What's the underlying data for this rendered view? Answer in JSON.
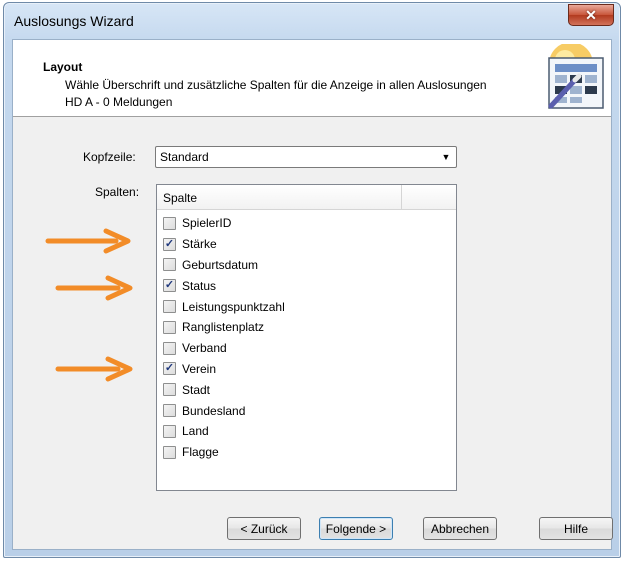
{
  "window": {
    "title": "Auslosungs Wizard",
    "close_glyph": "✕"
  },
  "header": {
    "title": "Layout",
    "description": "Wähle Überschrift und zusätzliche Spalten für die Anzeige in allen Auslosungen",
    "subtitle": "HD A - 0 Meldungen",
    "icon": "wizard-grid-icon"
  },
  "kopfzeile": {
    "label": "Kopfzeile:",
    "value": "Standard"
  },
  "spalten": {
    "label": "Spalten:",
    "column_header": "Spalte",
    "items": [
      {
        "label": "SpielerID",
        "checked": false
      },
      {
        "label": "Stärke",
        "checked": true
      },
      {
        "label": "Geburtsdatum",
        "checked": false
      },
      {
        "label": "Status",
        "checked": true
      },
      {
        "label": "Leistungspunktzahl",
        "checked": false
      },
      {
        "label": "Ranglistenplatz",
        "checked": false
      },
      {
        "label": "Verband",
        "checked": false
      },
      {
        "label": "Verein",
        "checked": true
      },
      {
        "label": "Stadt",
        "checked": false
      },
      {
        "label": "Bundesland",
        "checked": false
      },
      {
        "label": "Land",
        "checked": false
      },
      {
        "label": "Flagge",
        "checked": false
      }
    ]
  },
  "buttons": {
    "back": "< Zurück",
    "next": "Folgende >",
    "cancel": "Abbrechen",
    "help": "Hilfe"
  },
  "colors": {
    "annotation_arrow": "#f28c28",
    "checkmark": "#21397d"
  }
}
